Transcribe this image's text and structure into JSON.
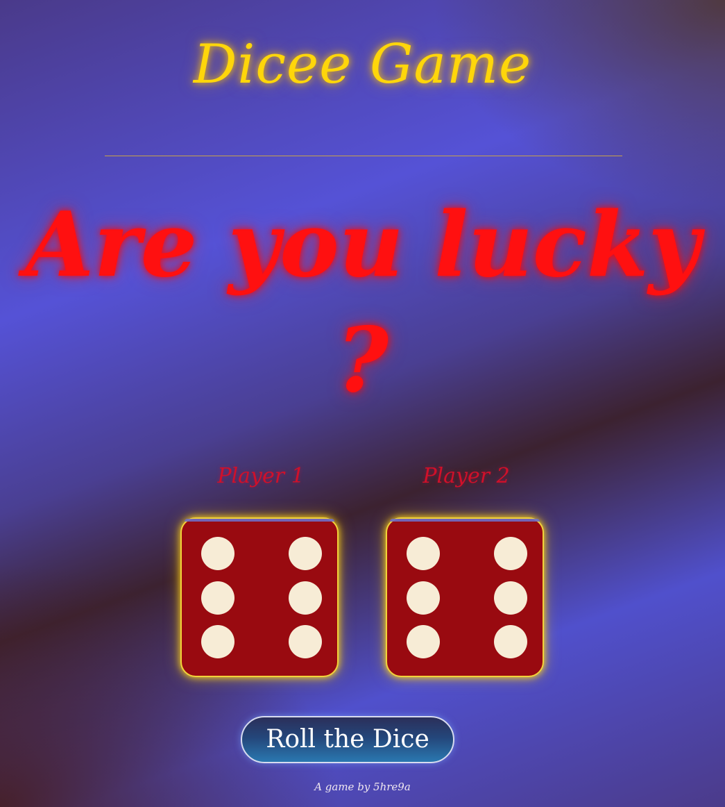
{
  "header": {
    "title": "Dicee Game"
  },
  "main": {
    "headline": "Are you lucky ?",
    "players": [
      {
        "label": "Player 1",
        "die_value": 6
      },
      {
        "label": "Player 2",
        "die_value": 6
      }
    ],
    "roll_button_label": "Roll the Dice"
  },
  "footer": {
    "credit": "A game by 5hre9a"
  },
  "colors": {
    "title": "#ffd60a",
    "headline": "#ff1010",
    "player_label": "#d0102a",
    "die_face": "#990a10",
    "pip": "#f7ecd6",
    "die_glow": "#f2d23a"
  }
}
